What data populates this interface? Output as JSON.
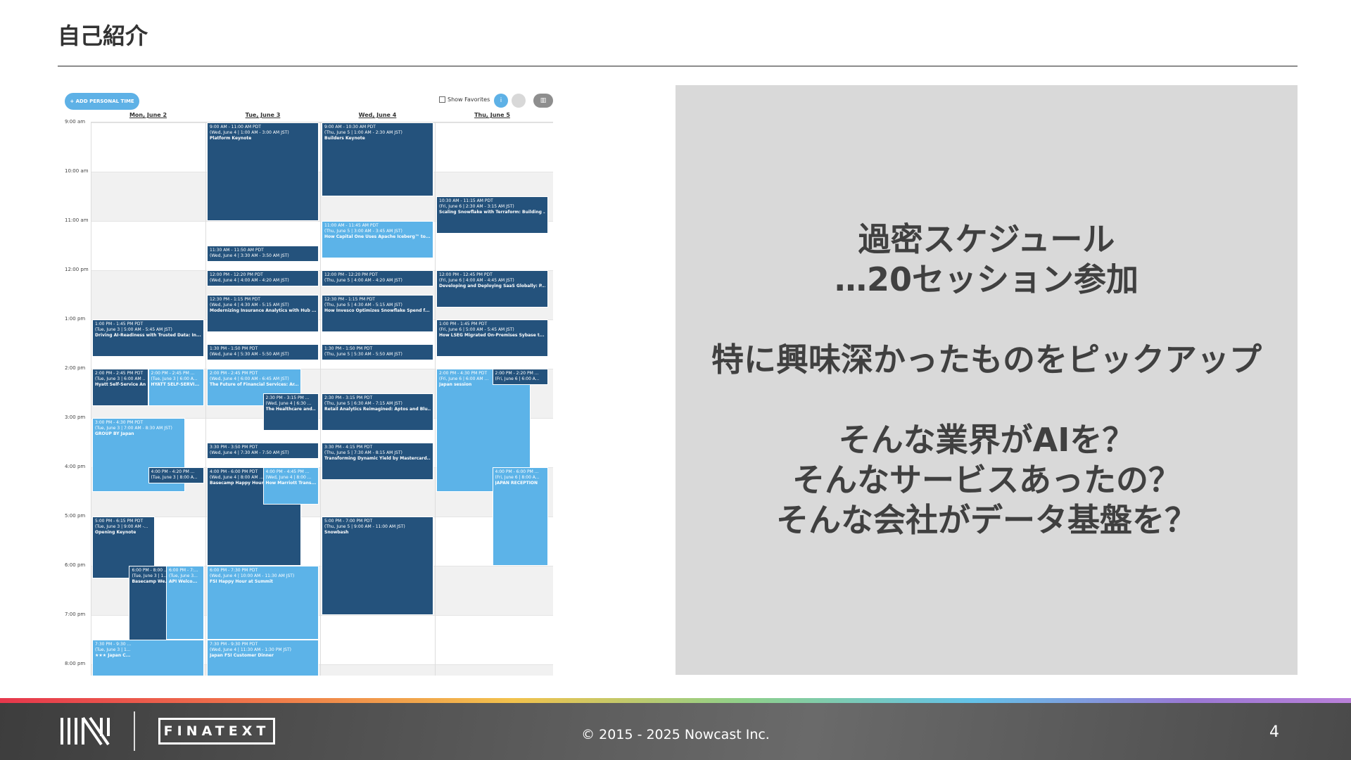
{
  "slide": {
    "title": "自己紹介",
    "page_number": "4"
  },
  "calendar": {
    "add_button": "+ ADD PERSONAL TIME",
    "show_favorites": "Show Favorites",
    "info_icon": "i",
    "view_icon": "▥",
    "days": [
      "Mon, June 2",
      "Tue, June 3",
      "Wed, June 4",
      "Thu, June 5"
    ],
    "times": [
      "9:00 am",
      "10:00 am",
      "11:00 am",
      "12:00 pm",
      "1:00 pm",
      "2:00 pm",
      "3:00 pm",
      "4:00 pm",
      "5:00 pm",
      "6:00 pm",
      "7:00 pm",
      "8:00 pm"
    ],
    "events": [
      {
        "time": "1:00 PM - 1:45 PM PDT",
        "sub": "(Tue, June 3 | 5:00 AM - 5:45 AM JST)",
        "name": "Driving AI-Readiness with Trusted Data: In...",
        "color": "dark"
      },
      {
        "time": "2:00 PM - 2:45 PM PDT",
        "sub": "(Tue, June 3 | 6:00 AM ...",
        "name": "Hyatt Self-Service Ana...",
        "color": "dark"
      },
      {
        "time": "2:00 PM - 2:45 PM ...",
        "sub": "(Tue, June 3 | 6:00 A...",
        "name": "HYATT SELF-SERVI...",
        "color": "light"
      },
      {
        "time": "3:00 PM - 4:30 PM PDT",
        "sub": "(Tue, June 3 | 7:00 AM - 8:30 AM JST)",
        "name": "GROUP BY Japan",
        "color": "light"
      },
      {
        "time": "4:00 PM - 4:20 PM ...",
        "sub": "(Tue, June 3 | 8:00 A...",
        "name": "",
        "color": "dark"
      },
      {
        "time": "5:00 PM - 6:15 PM PDT",
        "sub": "(Tue, June 3 | 9:00 AM -...",
        "name": "Opening Keynote",
        "color": "dark"
      },
      {
        "time": "6:00 PM - 8:00 ...",
        "sub": "(Tue, June 3 | 1...",
        "name": "Basecamp We...",
        "color": "dark"
      },
      {
        "time": "6:00 PM - 7:...",
        "sub": "(Tue, June 3...",
        "name": "API Welco...",
        "color": "light"
      },
      {
        "time": "7:30 PM - 9:30 ...",
        "sub": "(Tue, June 3 | 1...",
        "name": "★★★ Japan C...",
        "color": "light"
      },
      {
        "time": "9:00 AM - 11:00 AM PDT",
        "sub": "(Wed, June 4 | 1:00 AM - 3:00 AM JST)",
        "name": "Platform Keynote",
        "color": "dark"
      },
      {
        "time": "11:30 AM - 11:50 AM PDT",
        "sub": "(Wed, June 4 | 3:30 AM - 3:50 AM JST)",
        "name": "",
        "color": "dark"
      },
      {
        "time": "12:00 PM - 12:20 PM PDT",
        "sub": "(Wed, June 4 | 4:00 AM - 4:20 AM JST)",
        "name": "",
        "color": "dark"
      },
      {
        "time": "12:30 PM - 1:15 PM PDT",
        "sub": "(Wed, June 4 | 4:30 AM - 5:15 AM JST)",
        "name": "Modernizing Insurance Analytics with Hub ...",
        "color": "dark"
      },
      {
        "time": "1:30 PM - 1:50 PM PDT",
        "sub": "(Wed, June 4 | 5:30 AM - 5:50 AM JST)",
        "name": "",
        "color": "dark"
      },
      {
        "time": "2:00 PM - 2:45 PM PDT",
        "sub": "(Wed, June 4 | 6:00 AM - 6:45 AM JST)",
        "name": "The Future of Financial Services: Ar...",
        "color": "light"
      },
      {
        "time": "2:30 PM - 3:15 PM ...",
        "sub": "(Wed, June 4 | 6:30 ...",
        "name": "The Healthcare and...",
        "color": "dark"
      },
      {
        "time": "3:30 PM - 3:50 PM PDT",
        "sub": "(Wed, June 4 | 7:30 AM - 7:50 AM JST)",
        "name": "",
        "color": "dark"
      },
      {
        "time": "4:00 PM - 6:00 PM PDT",
        "sub": "(Wed, June 4 | 8:00 AM ...",
        "name": "Basecamp Happy Hour",
        "color": "dark"
      },
      {
        "time": "4:00 PM - 4:45 PM ...",
        "sub": "(Wed, June 4 | 8:00 ...",
        "name": "How Marriott Trans...",
        "color": "light"
      },
      {
        "time": "6:00 PM - 7:30 PM PDT",
        "sub": "(Wed, June 4 | 10:00 AM - 11:30 AM JST)",
        "name": "FSI Happy Hour at Summit",
        "color": "light"
      },
      {
        "time": "7:30 PM - 9:30 PM PDT",
        "sub": "(Wed, June 4 | 11:30 AM - 1:30 PM JST)",
        "name": "Japan FSI Customer Dinner",
        "color": "light"
      },
      {
        "time": "9:00 AM - 10:30 AM PDT",
        "sub": "(Thu, June 5 | 1:00 AM - 2:30 AM JST)",
        "name": "Builders Keynote",
        "color": "dark"
      },
      {
        "time": "11:00 AM - 11:45 AM PDT",
        "sub": "(Thu, June 5 | 3:00 AM - 3:45 AM JST)",
        "name": "How Capital One Uses Apache Iceberg™ to...",
        "color": "light"
      },
      {
        "time": "12:00 PM - 12:20 PM PDT",
        "sub": "(Thu, June 5 | 4:00 AM - 4:20 AM JST)",
        "name": "",
        "color": "dark"
      },
      {
        "time": "12:30 PM - 1:15 PM PDT",
        "sub": "(Thu, June 5 | 4:30 AM - 5:15 AM JST)",
        "name": "How Invesco Optimizes Snowflake Spend f...",
        "color": "dark"
      },
      {
        "time": "1:30 PM - 1:50 PM PDT",
        "sub": "(Thu, June 5 | 5:30 AM - 5:50 AM JST)",
        "name": "",
        "color": "dark"
      },
      {
        "time": "2:30 PM - 3:15 PM PDT",
        "sub": "(Thu, June 5 | 6:30 AM - 7:15 AM JST)",
        "name": "Retail Analytics Reimagined: Aptos and Blu...",
        "color": "dark"
      },
      {
        "time": "3:30 PM - 4:15 PM PDT",
        "sub": "(Thu, June 5 | 7:30 AM - 8:15 AM JST)",
        "name": "Transforming Dynamic Yield by Mastercard...",
        "color": "dark"
      },
      {
        "time": "5:00 PM - 7:00 PM PDT",
        "sub": "(Thu, June 5 | 9:00 AM - 11:00 AM JST)",
        "name": "Snowbash",
        "color": "dark"
      },
      {
        "time": "10:30 AM - 11:15 AM PDT",
        "sub": "(Fri, June 6 | 2:30 AM - 3:15 AM JST)",
        "name": "Scaling Snowflake with Terraform: Building ...",
        "color": "dark"
      },
      {
        "time": "12:00 PM - 12:45 PM PDT",
        "sub": "(Fri, June 6 | 4:00 AM - 4:45 AM JST)",
        "name": "Developing and Deploying SaaS Globally: P...",
        "color": "dark"
      },
      {
        "time": "1:00 PM - 1:45 PM PDT",
        "sub": "(Fri, June 6 | 5:00 AM - 5:45 AM JST)",
        "name": "How LSEG Migrated On-Premises Sybase t...",
        "color": "dark"
      },
      {
        "time": "2:00 PM - 4:30 PM PDT",
        "sub": "(Fri, June 6 | 6:00 AM ...",
        "name": "Japan session",
        "color": "light"
      },
      {
        "time": "2:00 PM - 2:20 PM ...",
        "sub": "(Fri, June 6 | 6:00 A...",
        "name": "",
        "color": "dark"
      },
      {
        "time": "4:00 PM - 6:00 PM ...",
        "sub": "(Fri, June 6 | 8:00 A...",
        "name": "JAPAN RECEPTION",
        "color": "light"
      }
    ]
  },
  "panel": {
    "lines": [
      "過密スケジュール",
      "…20セッション参加",
      "",
      "特に興味深かったものをピックアップ",
      "",
      "そんな業界がAIを？",
      "そんなサービスあったの？",
      "そんな会社がデータ基盤を？"
    ]
  },
  "footer": {
    "copyright": "© 2015 - 2025 Nowcast Inc.",
    "logo_text": "FINATEXT"
  }
}
